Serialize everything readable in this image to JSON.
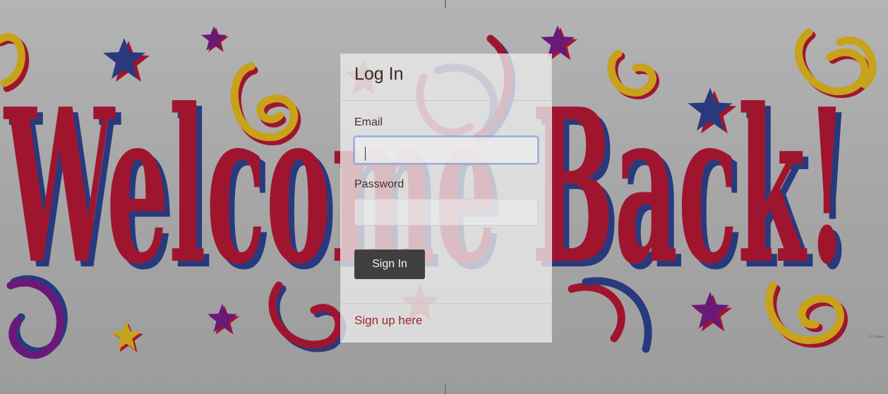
{
  "banner": {
    "headline": "Welcome Back!",
    "colors": {
      "red": "#a0152e",
      "blue": "#283a7d",
      "gold": "#c7a21a",
      "purple": "#6a1978"
    },
    "credit": "© Creative"
  },
  "login": {
    "title": "Log In",
    "email_label": "Email",
    "email_value": "",
    "password_label": "Password",
    "password_value": "",
    "sign_in_label": "Sign In",
    "signup_link": "Sign up here"
  },
  "theme": {
    "link_color": "#a5212f",
    "button_bg": "#3f3f3f"
  }
}
